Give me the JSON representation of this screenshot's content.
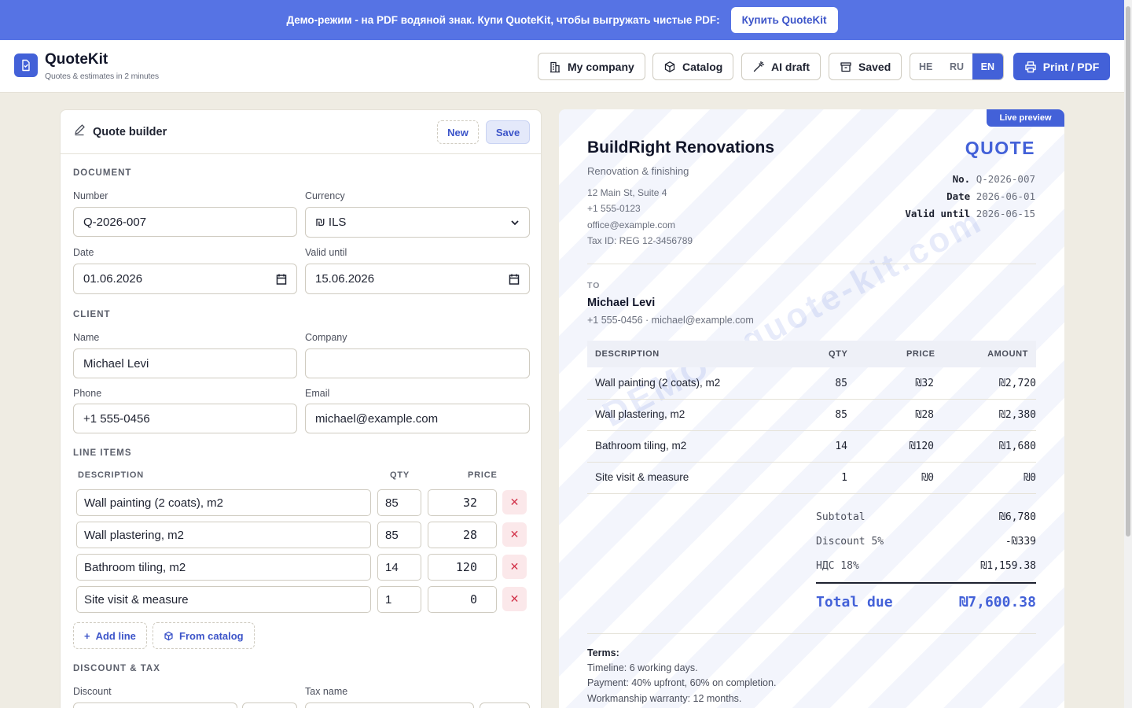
{
  "banner": {
    "text": "Демо-режим - на PDF водяной знак. Купи QuoteKit, чтобы выгружать чистые PDF:",
    "button": "Купить QuoteKit"
  },
  "header": {
    "title": "QuoteKit",
    "subtitle": "Quotes & estimates in 2 minutes",
    "buttons": {
      "my_company": "My company",
      "catalog": "Catalog",
      "ai_draft": "AI draft",
      "saved": "Saved"
    },
    "languages": [
      "HE",
      "RU",
      "EN"
    ],
    "active_language": "EN",
    "print": "Print / PDF"
  },
  "builder": {
    "title": "Quote builder",
    "new": "New",
    "save": "Save",
    "document": {
      "section": "DOCUMENT",
      "number_label": "Number",
      "number": "Q-2026-007",
      "currency_label": "Currency",
      "currency": "₪ ILS",
      "date_label": "Date",
      "date": "01.06.2026",
      "valid_label": "Valid until",
      "valid": "15.06.2026"
    },
    "client": {
      "section": "CLIENT",
      "name_label": "Name",
      "name": "Michael Levi",
      "company_label": "Company",
      "company": "",
      "phone_label": "Phone",
      "phone": "+1 555-0456",
      "email_label": "Email",
      "email": "michael@example.com"
    },
    "line_items": {
      "section": "LINE ITEMS",
      "headers": {
        "description": "DESCRIPTION",
        "qty": "QTY",
        "price": "PRICE"
      },
      "rows": [
        {
          "description": "Wall painting (2 coats), m2",
          "qty": "85",
          "price": "32"
        },
        {
          "description": "Wall plastering, m2",
          "qty": "85",
          "price": "28"
        },
        {
          "description": "Bathroom tiling, m2",
          "qty": "14",
          "price": "120"
        },
        {
          "description": "Site visit & measure",
          "qty": "1",
          "price": "0"
        }
      ],
      "add_line": "Add line",
      "from_catalog": "From catalog"
    },
    "discount_tax": {
      "section": "DISCOUNT & TAX",
      "discount_label": "Discount",
      "tax_label": "Tax name"
    }
  },
  "preview": {
    "badge": "Live preview",
    "watermark": "DEMO · quote-kit.com",
    "company": "BuildRight Renovations",
    "tagline": "Renovation & finishing",
    "address": "12 Main St, Suite 4",
    "phone": "+1 555-0123",
    "email": "office@example.com",
    "tax_id": "Tax ID: REG 12-3456789",
    "doc_type": "QUOTE",
    "meta": {
      "no_label": "No.",
      "no": "Q-2026-007",
      "date_label": "Date",
      "date": "2026-06-01",
      "valid_label": "Valid until",
      "valid": "2026-06-15"
    },
    "to_label": "TO",
    "client_name": "Michael Levi",
    "client_contact": "+1 555-0456 · michael@example.com",
    "table": {
      "headers": {
        "description": "DESCRIPTION",
        "qty": "QTY",
        "price": "PRICE",
        "amount": "AMOUNT"
      },
      "rows": [
        {
          "description": "Wall painting (2 coats), m2",
          "qty": "85",
          "price": "₪32",
          "amount": "₪2,720"
        },
        {
          "description": "Wall plastering, m2",
          "qty": "85",
          "price": "₪28",
          "amount": "₪2,380"
        },
        {
          "description": "Bathroom tiling, m2",
          "qty": "14",
          "price": "₪120",
          "amount": "₪1,680"
        },
        {
          "description": "Site visit & measure",
          "qty": "1",
          "price": "₪0",
          "amount": "₪0"
        }
      ]
    },
    "totals": {
      "subtotal_label": "Subtotal",
      "subtotal": "₪6,780",
      "discount_label": "Discount 5%",
      "discount": "-₪339",
      "tax_label": "НДС 18%",
      "tax": "₪1,159.38",
      "total_label": "Total due",
      "total": "₪7,600.38"
    },
    "terms": {
      "title": "Terms:",
      "lines": [
        "Timeline: 6 working days.",
        "Payment: 40% upfront, 60% on completion.",
        "Workmanship warranty: 12 months."
      ]
    }
  },
  "colors": {
    "accent": "#4361d8",
    "banner": "#5673e4",
    "background": "#efece3",
    "danger": "#d2334a"
  },
  "icons": [
    "document-icon",
    "building-icon",
    "box-icon",
    "wand-icon",
    "archive-icon",
    "printer-icon",
    "pencil-icon",
    "calendar-icon",
    "chevron-down-icon",
    "close-icon",
    "plus-icon"
  ]
}
